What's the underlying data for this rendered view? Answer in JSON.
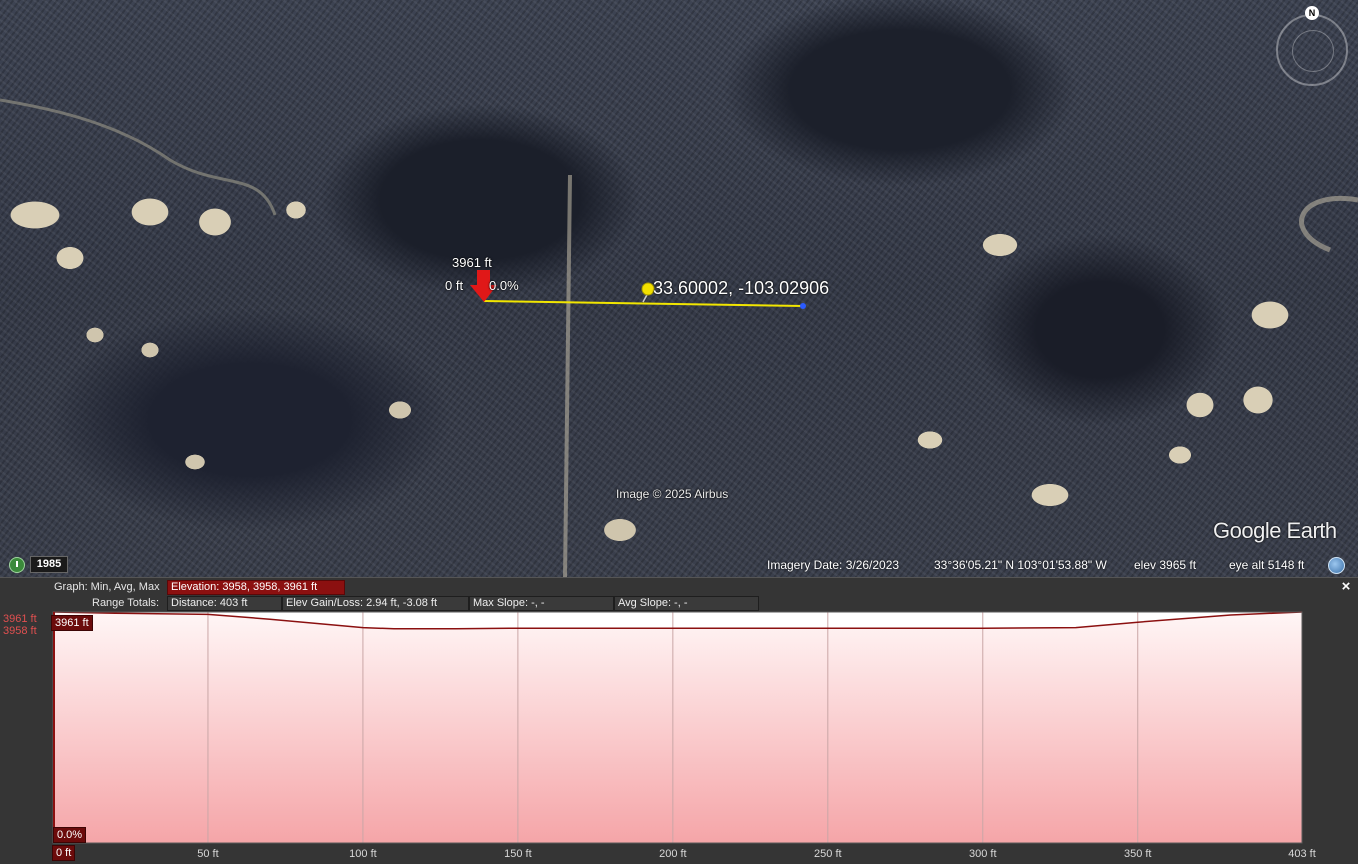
{
  "map": {
    "pin": {
      "elevation": "3961 ft",
      "distance": "0 ft",
      "slope": "0.0%"
    },
    "placemark_label": "33.60002, -103.02906",
    "copyright": "Image © 2025 Airbus",
    "logo": "Google Earth",
    "compass_letter": "N",
    "historical_year": "1985",
    "status": {
      "imagery_date": "Imagery Date: 3/26/2023",
      "lat_long": "33°36'05.21\" N  103°01'53.88\" W",
      "elev": "elev  3965 ft",
      "eye_alt": "eye alt   5148 ft"
    },
    "icons": [
      "clock-icon",
      "globe-icon",
      "compass-icon",
      "pushpin-icon",
      "arrow-marker-icon"
    ],
    "path_color": "#f2e600"
  },
  "panel": {
    "graph_label": "Graph: Min, Avg, Max",
    "range_label": "Range Totals:",
    "elevation_summary": "Elevation: 3958, 3958, 3961 ft",
    "distance": "Distance: 403 ft",
    "elev_gain_loss": "Elev Gain/Loss: 2.94 ft, -3.08 ft",
    "max_slope": "Max Slope: -, -",
    "avg_slope": "Avg Slope: -, -",
    "y_axis": {
      "max": "3961 ft",
      "min": "3958 ft"
    },
    "max_tag": "3961 ft",
    "slope_tag": "0.0%",
    "position_tag": "0 ft",
    "close": "×"
  },
  "chart_data": {
    "type": "area",
    "xlabel": "",
    "ylabel": "",
    "x_ticks": [
      "0 ft",
      "50 ft",
      "100 ft",
      "150 ft",
      "200 ft",
      "250 ft",
      "300 ft",
      "350 ft",
      "403 ft"
    ],
    "x": [
      0,
      20,
      50,
      70,
      100,
      110,
      130,
      150,
      200,
      250,
      300,
      330,
      350,
      380,
      403
    ],
    "y": [
      3961,
      3960.8,
      3960.6,
      3959.8,
      3958.4,
      3958.2,
      3958.2,
      3958.3,
      3958.3,
      3958.3,
      3958.3,
      3958.4,
      3959.3,
      3960.5,
      3961
    ],
    "xlim": [
      0,
      403
    ],
    "ylim": [
      3958,
      3961
    ],
    "grid": true,
    "fill_color": "#f5a5a8",
    "line_color": "#8b1010"
  }
}
